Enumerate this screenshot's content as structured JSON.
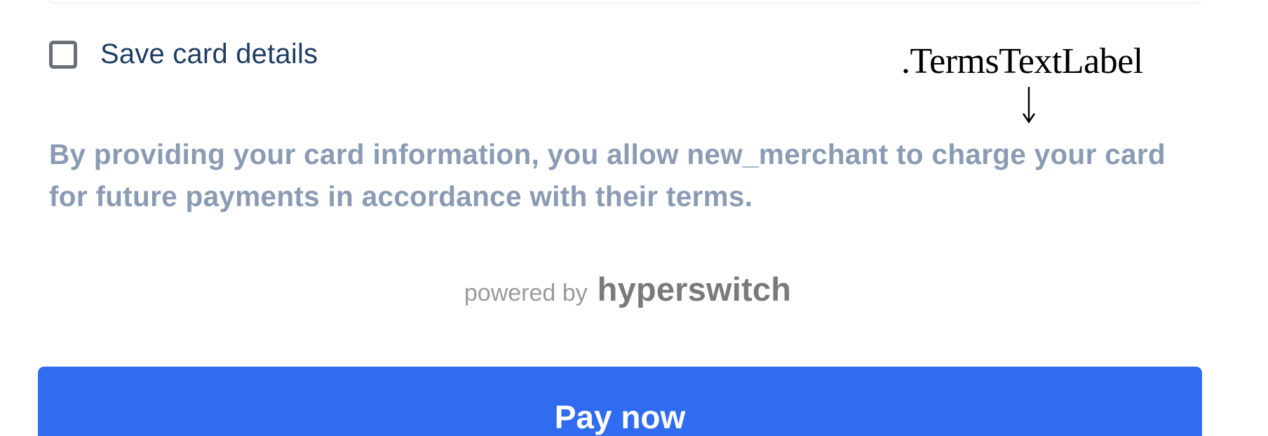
{
  "form": {
    "save_card_label": "Save card details",
    "save_card_checked": false,
    "terms_text": "By providing your card information, you allow new_merchant to charge your card for future payments in accordance with their terms.",
    "pay_button_label": "Pay now"
  },
  "annotation": {
    "label": ".TermsTextLabel"
  },
  "branding": {
    "powered_by": "powered by",
    "brand_name": "hyperswitch"
  },
  "colors": {
    "accent": "#306cf0",
    "label_text": "#1f3d63",
    "terms_text": "#8a9bb3"
  },
  "icons": {
    "arrow": "arrow-down-icon",
    "checkbox": "checkbox-icon"
  }
}
